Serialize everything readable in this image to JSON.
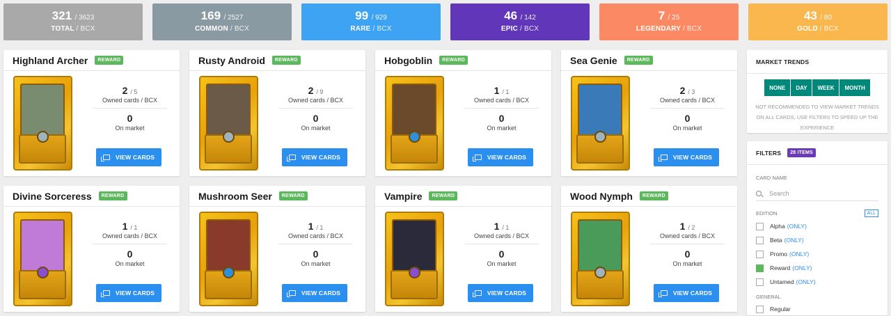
{
  "stats": [
    {
      "count": "321",
      "total": "/ 3623",
      "label": "TOTAL",
      "unit": "/ BCX",
      "color": "#a9a9a9"
    },
    {
      "count": "169",
      "total": "/ 2527",
      "label": "COMMON",
      "unit": "/ BCX",
      "color": "#8a9aa3"
    },
    {
      "count": "99",
      "total": "/ 929",
      "label": "RARE",
      "unit": "/ BCX",
      "color": "#3ea3f3"
    },
    {
      "count": "46",
      "total": "/ 142",
      "label": "EPIC",
      "unit": "/ BCX",
      "color": "#6236b8"
    },
    {
      "count": "7",
      "total": "/ 25",
      "label": "LEGENDARY",
      "unit": "/ BCX",
      "color": "#fb8a64"
    },
    {
      "count": "43",
      "total": "/ 80",
      "label": "GOLD",
      "unit": "/ BCX",
      "color": "#f9b74e"
    }
  ],
  "cards": [
    {
      "name": "Highland Archer",
      "badge": "REWARD",
      "owned": "2",
      "owned_total": "/ 5",
      "owned_label": "Owned cards / BCX",
      "market": "0",
      "market_label": "On market",
      "button": "VIEW CARDS",
      "window_color": "#7a8c70",
      "gem_color": "#9fb3bd"
    },
    {
      "name": "Rusty Android",
      "badge": "REWARD",
      "owned": "2",
      "owned_total": "/ 9",
      "owned_label": "Owned cards / BCX",
      "market": "0",
      "market_label": "On market",
      "button": "VIEW CARDS",
      "window_color": "#6b5a48",
      "gem_color": "#9fb3bd"
    },
    {
      "name": "Hobgoblin",
      "badge": "REWARD",
      "owned": "1",
      "owned_total": "/ 1",
      "owned_label": "Owned cards / BCX",
      "market": "0",
      "market_label": "On market",
      "button": "VIEW CARDS",
      "window_color": "#6a4a2a",
      "gem_color": "#2f8fd8"
    },
    {
      "name": "Sea Genie",
      "badge": "REWARD",
      "owned": "2",
      "owned_total": "/ 3",
      "owned_label": "Owned cards / BCX",
      "market": "0",
      "market_label": "On market",
      "button": "VIEW CARDS",
      "window_color": "#3a7ab8",
      "gem_color": "#9fb3bd"
    },
    {
      "name": "Divine Sorceress",
      "badge": "REWARD",
      "owned": "1",
      "owned_total": "/ 1",
      "owned_label": "Owned cards / BCX",
      "market": "0",
      "market_label": "On market",
      "button": "VIEW CARDS",
      "window_color": "#c07ad8",
      "gem_color": "#8a4fd0"
    },
    {
      "name": "Mushroom Seer",
      "badge": "REWARD",
      "owned": "1",
      "owned_total": "/ 1",
      "owned_label": "Owned cards / BCX",
      "market": "0",
      "market_label": "On market",
      "button": "VIEW CARDS",
      "window_color": "#8a3a2a",
      "gem_color": "#2f8fd8"
    },
    {
      "name": "Vampire",
      "badge": "REWARD",
      "owned": "1",
      "owned_total": "/ 1",
      "owned_label": "Owned cards / BCX",
      "market": "0",
      "market_label": "On market",
      "button": "VIEW CARDS",
      "window_color": "#2a2a3a",
      "gem_color": "#8a4fd0"
    },
    {
      "name": "Wood Nymph",
      "badge": "REWARD",
      "owned": "1",
      "owned_total": "/ 2",
      "owned_label": "Owned cards / BCX",
      "market": "0",
      "market_label": "On market",
      "button": "VIEW CARDS",
      "window_color": "#4a9a5a",
      "gem_color": "#9fb3bd"
    }
  ],
  "market_trends": {
    "title": "MARKET TRENDS",
    "buttons": [
      "NONE",
      "DAY",
      "WEEK",
      "MONTH"
    ],
    "note": "NOT RECOMMENDED TO VIEW MARKET TRENDS ON ALL CARDS, USE FILTERS TO SPEED UP THE EXPERIENCE"
  },
  "filters": {
    "title": "FILTERS",
    "count": "28 ITEMS",
    "card_name_label": "CARD NAME",
    "search_placeholder": "Search",
    "edition_label": "EDITION",
    "all_label": "ALL",
    "editions": [
      {
        "name": "Alpha",
        "only": "(ONLY)",
        "checked": false
      },
      {
        "name": "Beta",
        "only": "(ONLY)",
        "checked": false
      },
      {
        "name": "Promo",
        "only": "(ONLY)",
        "checked": false
      },
      {
        "name": "Reward",
        "only": "(ONLY)",
        "checked": true
      },
      {
        "name": "Untamed",
        "only": "(ONLY)",
        "checked": false
      }
    ],
    "general_label": "GENERAL",
    "general_first": "Regular"
  }
}
